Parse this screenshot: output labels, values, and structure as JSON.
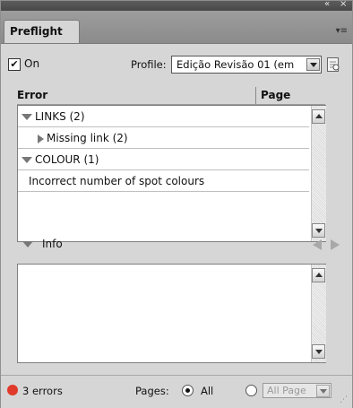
{
  "panel": {
    "tab_label": "Preflight",
    "collapse_glyph": "«",
    "close_glyph": "×",
    "menu_glyph": "▾≡"
  },
  "options": {
    "on_checked": true,
    "on_label": "On",
    "profile_label": "Profile:",
    "profile_value": "Edição Revisão 01 (em"
  },
  "list": {
    "col_error": "Error",
    "col_page": "Page",
    "rows": [
      {
        "text": "LINKS (2)",
        "type": "group"
      },
      {
        "text": "Missing link (2)",
        "type": "item"
      },
      {
        "text": "COLOUR (1)",
        "type": "group"
      },
      {
        "text": "Incorrect number of spot colours",
        "type": "leaf"
      }
    ]
  },
  "info": {
    "label": "Info"
  },
  "footer": {
    "status_color": "#e03a2a",
    "errors_text": "3 errors",
    "pages_label": "Pages:",
    "all_label": "All",
    "all_selected": true,
    "range_placeholder": "All Page"
  }
}
